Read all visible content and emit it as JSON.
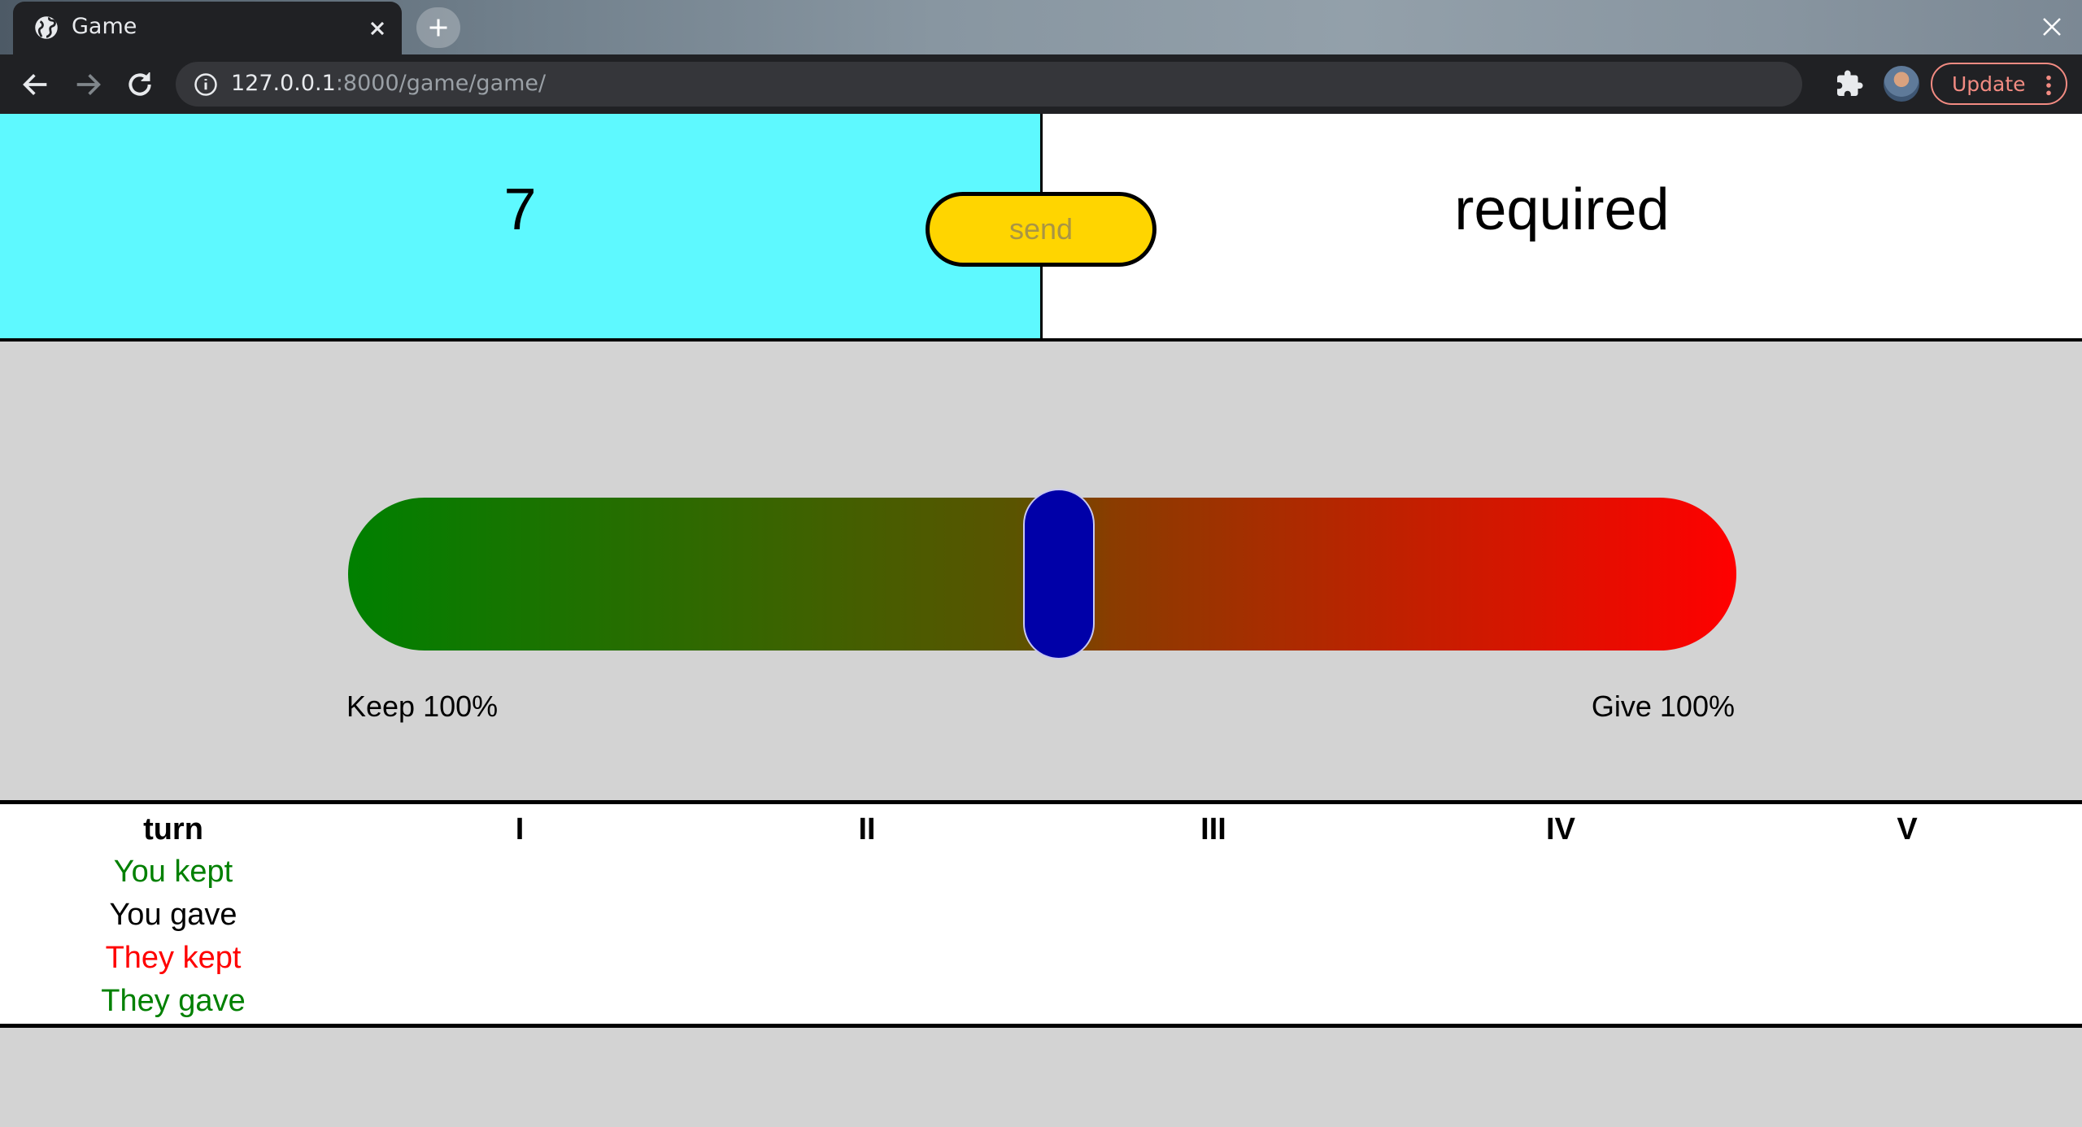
{
  "browser": {
    "tab_title": "Game",
    "url_host": "127.0.0.1",
    "url_rest": ":8000/game/game/",
    "update_label": "Update"
  },
  "game": {
    "counter": "7",
    "status": "required",
    "send_label": "send",
    "slider": {
      "value_fraction": 0.5,
      "left_label": "Keep 100%",
      "right_label": "Give 100%",
      "colors": {
        "left": "#008000",
        "right": "#ff0000",
        "thumb": "#0000a8"
      }
    },
    "colors": {
      "left_panel": "#5ef9ff",
      "send_button": "#ffd500",
      "background": "#d3d3d3"
    }
  },
  "history": {
    "headers": [
      "turn",
      "I",
      "II",
      "III",
      "IV",
      "V"
    ],
    "rows": [
      {
        "label": "You kept",
        "color": "#008000"
      },
      {
        "label": "You gave",
        "color": "#000000"
      },
      {
        "label": "They kept",
        "color": "#ff0000"
      },
      {
        "label": "They gave",
        "color": "#008000"
      }
    ]
  }
}
